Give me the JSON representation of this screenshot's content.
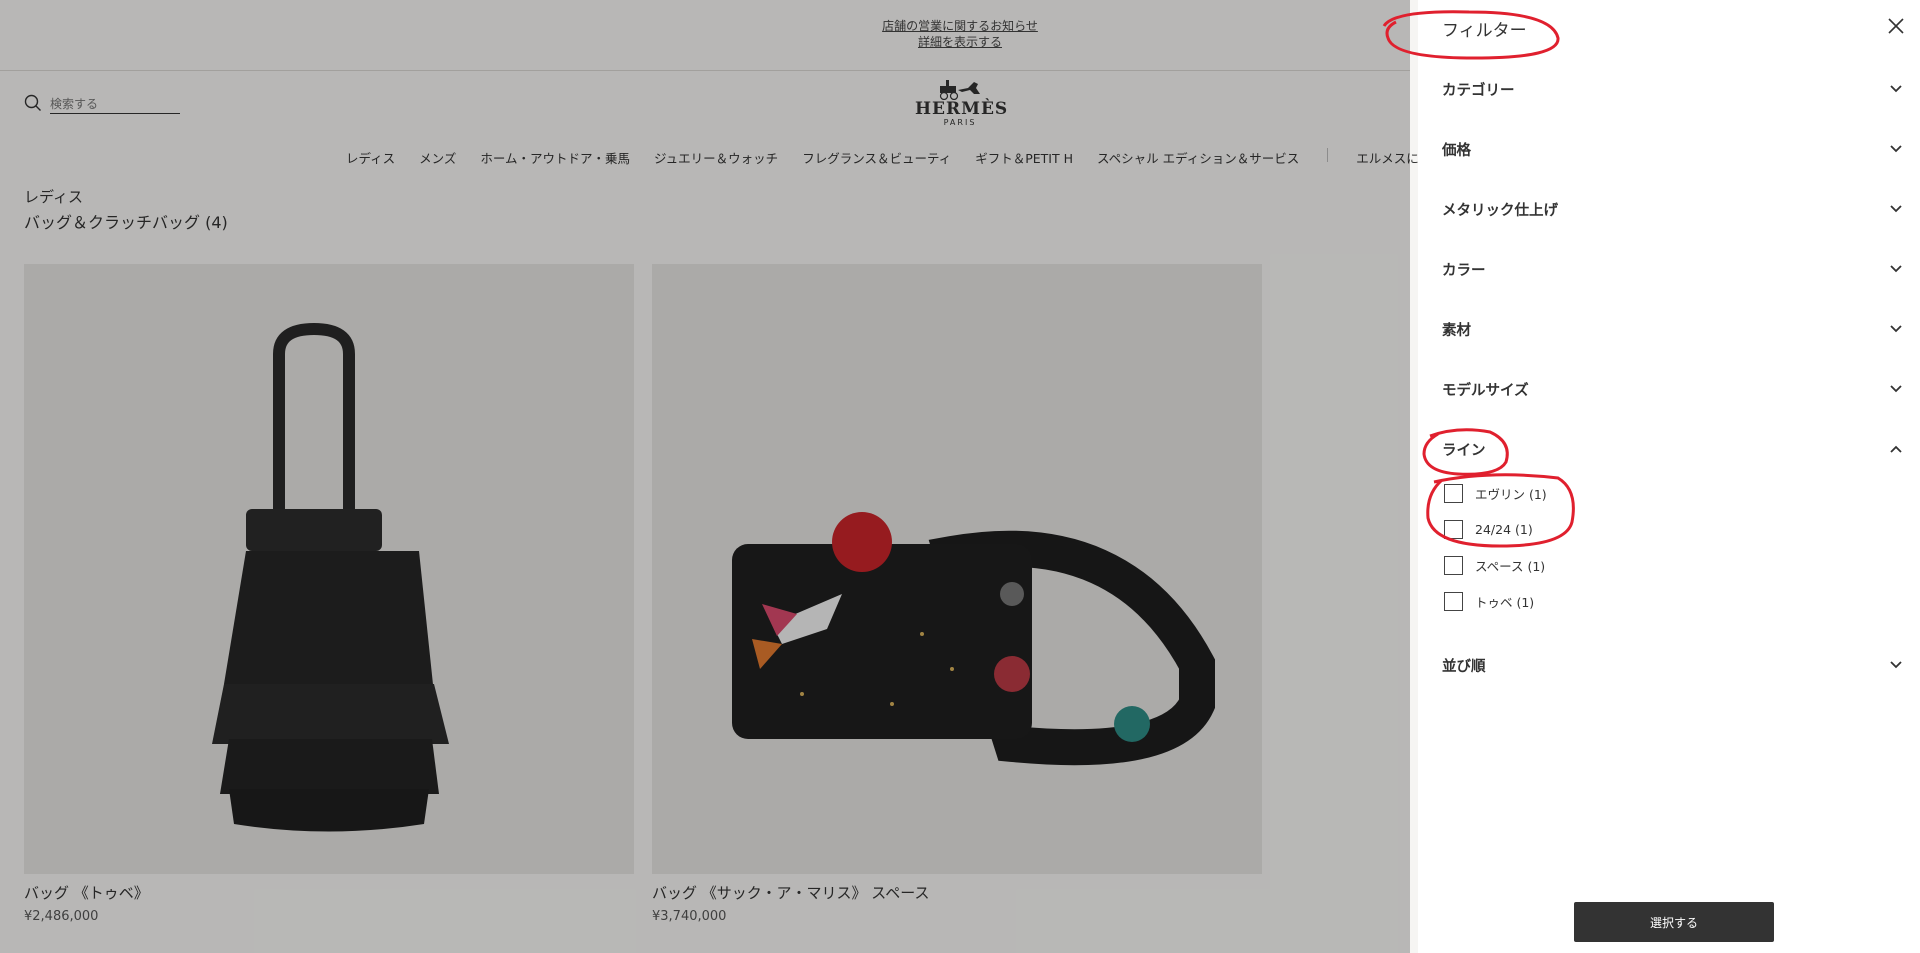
{
  "notice": {
    "line1": "店舗の営業に関するお知らせ",
    "line2": "詳細を表示する"
  },
  "search": {
    "placeholder": "検索する"
  },
  "logo": {
    "brand": "HERMÈS",
    "city": "PARIS"
  },
  "nav": [
    "レディス",
    "メンズ",
    "ホーム・アウトドア・乗馬",
    "ジュエリー＆ウォッチ",
    "フレグランス＆ビューティ",
    "ギフト＆PETIT H",
    "スペシャル エディション＆サービス",
    "エルメスについ"
  ],
  "breadcrumb": "レディス",
  "page_title": "バッグ＆クラッチバッグ (4)",
  "products": [
    {
      "name": "バッグ 《トゥベ》",
      "price": "¥2,486,000"
    },
    {
      "name": "バッグ 《サック・ア・マリス》 スペース",
      "price": "¥3,740,000"
    }
  ],
  "filter": {
    "title": "フィルター",
    "facets": [
      {
        "label": "カテゴリー",
        "expanded": false
      },
      {
        "label": "価格",
        "expanded": false
      },
      {
        "label": "メタリック仕上げ",
        "expanded": false
      },
      {
        "label": "カラー",
        "expanded": false
      },
      {
        "label": "素材",
        "expanded": false
      },
      {
        "label": "モデルサイズ",
        "expanded": false
      },
      {
        "label": "ライン",
        "expanded": true
      },
      {
        "label": "並び順",
        "expanded": false
      }
    ],
    "line_options": [
      {
        "label": "エヴリン (1)",
        "checked": false
      },
      {
        "label": "24/24 (1)",
        "checked": false
      },
      {
        "label": "スペース (1)",
        "checked": false
      },
      {
        "label": "トゥベ (1)",
        "checked": false
      }
    ],
    "submit_label": "選択する"
  },
  "colors": {
    "annotation": "#e0202e",
    "button_bg": "#333333",
    "overlay": "rgba(0,0,0,0.25)"
  }
}
